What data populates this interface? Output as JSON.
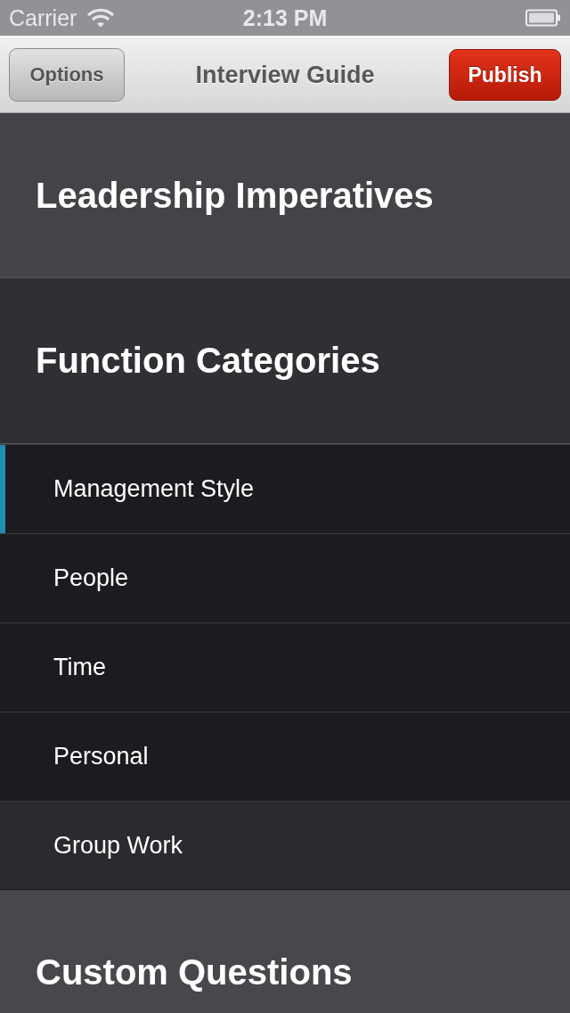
{
  "status_bar": {
    "carrier": "Carrier",
    "time": "2:13 PM"
  },
  "nav_bar": {
    "left_button": "Options",
    "title": "Interview Guide",
    "right_button": "Publish"
  },
  "sections": [
    {
      "title": "Leadership Imperatives",
      "expanded": false
    },
    {
      "title": "Function Categories",
      "expanded": true,
      "items": [
        {
          "label": "Management Style",
          "selected": true,
          "highlighted": false
        },
        {
          "label": "People",
          "selected": false,
          "highlighted": false
        },
        {
          "label": "Time",
          "selected": false,
          "highlighted": false
        },
        {
          "label": "Personal",
          "selected": false,
          "highlighted": false
        },
        {
          "label": "Group Work",
          "selected": false,
          "highlighted": true
        }
      ]
    },
    {
      "title": "Custom Questions",
      "expanded": false
    }
  ]
}
